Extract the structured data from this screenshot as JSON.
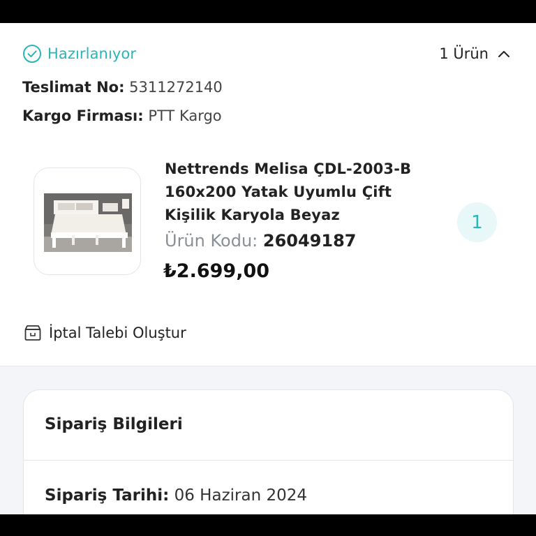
{
  "shipment": {
    "status": "Hazırlanıyor",
    "item_count": "1 Ürün",
    "delivery_label": "Teslimat No:",
    "delivery_no": "5311272140",
    "cargo_label": "Kargo Firması:",
    "cargo_company": "PTT Kargo"
  },
  "product": {
    "name": "Nettrends Melisa ÇDL-2003-B 160x200 Yatak Uyumlu Çift Kişilik Karyola Beyaz",
    "code_label": "Ürün Kodu:",
    "code": "26049187",
    "price": "₺2.699,00",
    "quantity": "1"
  },
  "actions": {
    "cancel_label": "İptal Talebi Oluştur"
  },
  "order_info": {
    "title": "Sipariş Bilgileri",
    "date_label": "Sipariş Tarihi:",
    "date": "06 Haziran 2024"
  },
  "icons": {
    "status": "check-circle-icon",
    "collapse": "chevron-up-icon",
    "cancel": "box-icon"
  },
  "colors": {
    "accent": "#2ab5b8",
    "qty_badge_bg": "#e8f7f8",
    "page_bg": "#f3f5f8"
  }
}
